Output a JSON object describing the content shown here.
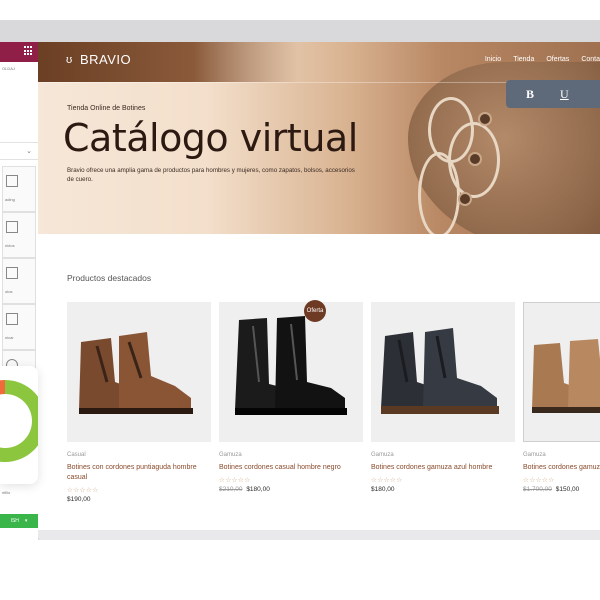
{
  "editor": {
    "sub_label": "OLDAJ",
    "widgets": [
      "ading",
      "nidos",
      "otos",
      "nicar",
      "n"
    ],
    "footer_label": "nfilio",
    "publish_label": "ISH"
  },
  "site": {
    "logo": "BRAVIO",
    "nav": [
      "Inicio",
      "Tienda",
      "Ofertas",
      "Conta"
    ],
    "toolbar": {
      "bold": "B",
      "underline": "U"
    },
    "hero": {
      "eyebrow": "Tienda Online de Botines",
      "title": "Catálogo virtual",
      "description": "Bravio ofrece una amplia gama de productos para hombres y mujeres, como zapatos, bolsos, accesorios de cuero."
    },
    "section_title": "Productos destacados",
    "badge": "Oferta",
    "products": [
      {
        "category": "Casual",
        "name": "Botines con cordones puntiaguda hombre casual",
        "stars": "☆☆☆☆☆",
        "old_price": "",
        "price": "$190,00"
      },
      {
        "category": "Gamuza",
        "name": "Botines cordones casual hombre negro",
        "stars": "☆☆☆☆☆",
        "old_price": "$210,00",
        "price": "$180,00"
      },
      {
        "category": "Gamuza",
        "name": "Botines cordones gamuza azul hombre",
        "stars": "☆☆☆☆☆",
        "old_price": "",
        "price": "$180,00"
      },
      {
        "category": "Gamuza",
        "name": "Botines cordones gamuza hombre",
        "stars": "☆☆☆☆☆",
        "old_price": "$1.700,00",
        "price": "$150,00"
      }
    ]
  },
  "colors": {
    "editor_accent": "#8f1f46",
    "publish_green": "#39b54a",
    "hero_text": "#2c1a12",
    "product_name": "#8a4a2c",
    "badge_bg": "#6e3a23"
  }
}
